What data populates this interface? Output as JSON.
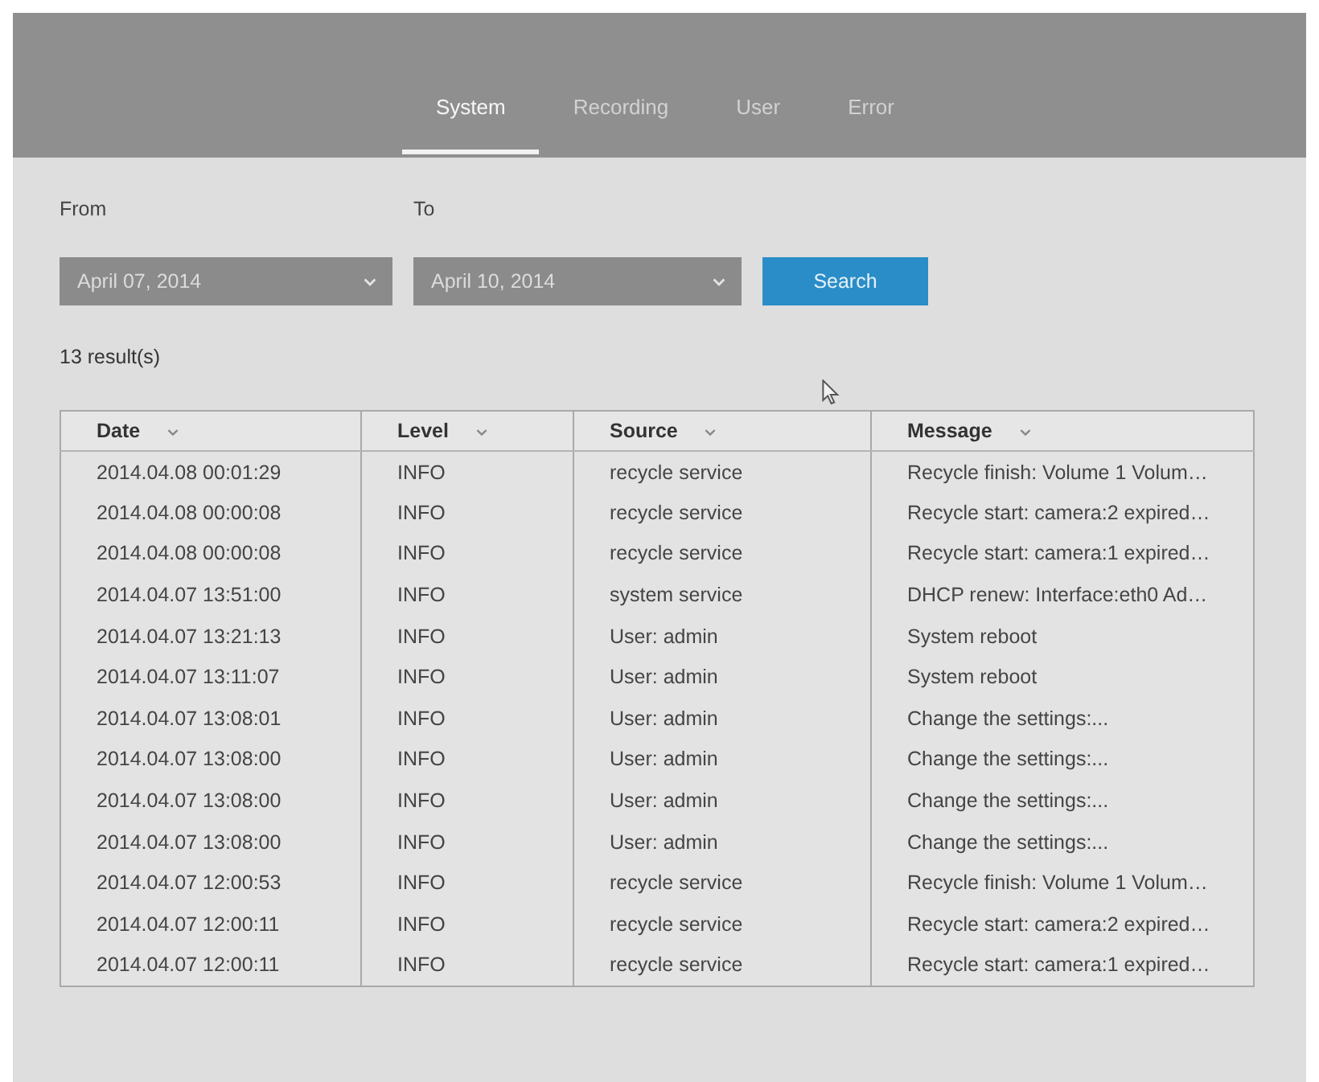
{
  "tabs": [
    {
      "label": "System",
      "selected": true
    },
    {
      "label": "Recording",
      "selected": false
    },
    {
      "label": "User",
      "selected": false
    },
    {
      "label": "Error",
      "selected": false
    }
  ],
  "filter": {
    "from": {
      "label": "From",
      "value": "April 07, 2014"
    },
    "to": {
      "label": "To",
      "value": "April 10, 2014"
    },
    "search_button": "Search"
  },
  "result_count": "13 result(s)",
  "table": {
    "columns": [
      "Date",
      "Level",
      "Source",
      "Message"
    ],
    "rows": [
      [
        "2014.04.08 00:01:29",
        "INFO",
        "recycle service",
        "Recycle finish: Volume 1 Volum…"
      ],
      [
        "2014.04.08 00:00:08",
        "INFO",
        "recycle service",
        "Recycle start: camera:2 expired…"
      ],
      [
        "2014.04.08 00:00:08",
        "INFO",
        "recycle service",
        "Recycle start: camera:1 expired…"
      ],
      [
        "2014.04.07 13:51:00",
        "INFO",
        "system service",
        "DHCP renew: Interface:eth0 Ad…"
      ],
      [
        "2014.04.07 13:21:13",
        "INFO",
        "User: admin",
        "System reboot"
      ],
      [
        "2014.04.07 13:11:07",
        "INFO",
        "User: admin",
        "System reboot"
      ],
      [
        "2014.04.07 13:08:01",
        "INFO",
        "User: admin",
        "Change the settings:..."
      ],
      [
        "2014.04.07 13:08:00",
        "INFO",
        "User: admin",
        "Change the settings:..."
      ],
      [
        "2014.04.07 13:08:00",
        "INFO",
        "User: admin",
        "Change the settings:..."
      ],
      [
        "2014.04.07 13:08:00",
        "INFO",
        "User: admin",
        "Change the settings:..."
      ],
      [
        "2014.04.07 12:00:53",
        "INFO",
        "recycle service",
        "Recycle finish: Volume 1 Volum…"
      ],
      [
        "2014.04.07 12:00:11",
        "INFO",
        "recycle service",
        "Recycle start: camera:2 expired…"
      ],
      [
        "2014.04.07 12:00:11",
        "INFO",
        "recycle service",
        "Recycle start: camera:1 expired…"
      ]
    ]
  }
}
